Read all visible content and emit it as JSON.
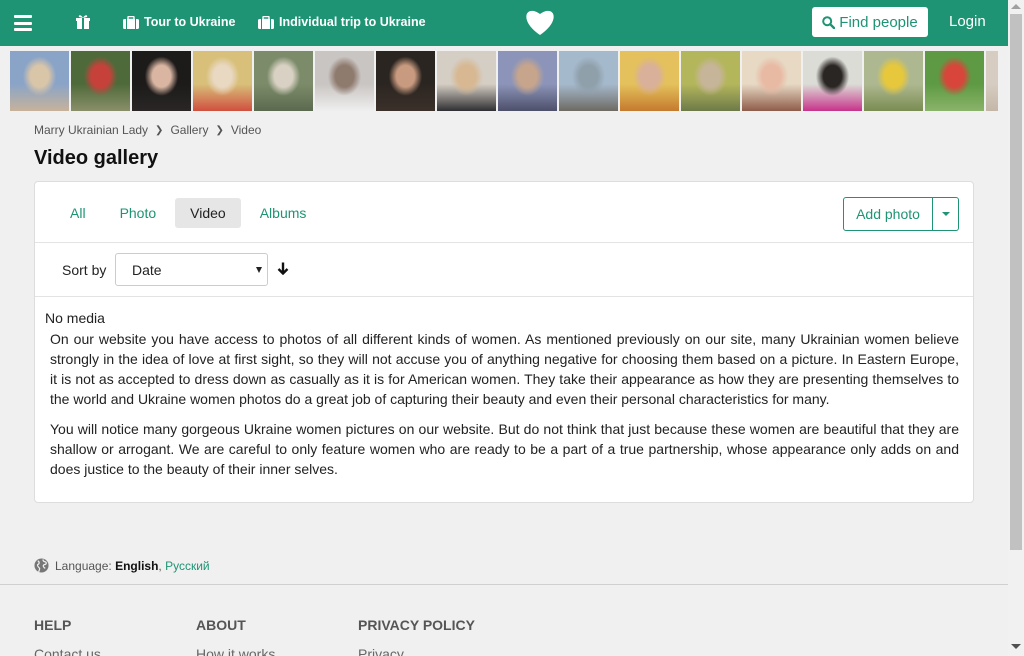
{
  "nav": {
    "tour_label": "Tour to Ukraine",
    "trip_label": "Individual trip to Ukraine",
    "find_label": "Find people",
    "login_label": "Login"
  },
  "strip": {
    "photos": [
      {
        "name": "profile-photo-1",
        "colors": [
          "#8aa4c8",
          "#d9c5a8",
          "#c7b29a"
        ]
      },
      {
        "name": "profile-photo-2",
        "colors": [
          "#4f6a3a",
          "#c7413b",
          "#8a8f6a"
        ]
      },
      {
        "name": "profile-photo-3",
        "colors": [
          "#1d1a1a",
          "#d9b5a2",
          "#2a2626"
        ]
      },
      {
        "name": "profile-photo-4",
        "colors": [
          "#d8c07a",
          "#e9d8c2",
          "#d04f3f"
        ]
      },
      {
        "name": "profile-photo-5",
        "colors": [
          "#7c8c6a",
          "#d9d2c4",
          "#5b6a4f"
        ]
      },
      {
        "name": "profile-photo-6",
        "colors": [
          "#c9c5c2",
          "#8f7a6e",
          "#efefef"
        ]
      },
      {
        "name": "profile-photo-7",
        "colors": [
          "#2b2521",
          "#c89a7f",
          "#3b302a"
        ]
      },
      {
        "name": "profile-photo-8",
        "colors": [
          "#d5cec4",
          "#d7b892",
          "#2f2f33"
        ]
      },
      {
        "name": "profile-photo-9",
        "colors": [
          "#8c95b9",
          "#c7a58c",
          "#4d4f6a"
        ]
      },
      {
        "name": "profile-photo-10",
        "colors": [
          "#a5b9cc",
          "#8fa0ab",
          "#6e6a63"
        ]
      },
      {
        "name": "profile-photo-11",
        "colors": [
          "#e4c15c",
          "#d9b09a",
          "#c57a2e"
        ]
      },
      {
        "name": "profile-photo-12",
        "colors": [
          "#b4b65c",
          "#c7b59a",
          "#6d7a48"
        ]
      },
      {
        "name": "profile-photo-13",
        "colors": [
          "#e7d9c4",
          "#e8b9a3",
          "#8e5c4a"
        ]
      },
      {
        "name": "profile-photo-14",
        "colors": [
          "#dcdcd6",
          "#2a2624",
          "#c7338a"
        ]
      },
      {
        "name": "profile-photo-15",
        "colors": [
          "#aeb890",
          "#e7c83c",
          "#7a8c52"
        ]
      },
      {
        "name": "profile-photo-16",
        "colors": [
          "#5e9a43",
          "#d8453a",
          "#8ab36a"
        ]
      },
      {
        "name": "profile-photo-17",
        "colors": [
          "#d7ccc1",
          "#5d7da8",
          "#c4b7a8"
        ]
      }
    ]
  },
  "breadcrumb": {
    "home": "Marry Ukrainian Lady",
    "gallery": "Gallery",
    "current": "Video"
  },
  "page": {
    "title": "Video gallery"
  },
  "tabs": {
    "all": "All",
    "photo": "Photo",
    "video": "Video",
    "albums": "Albums",
    "active": "video"
  },
  "actions": {
    "add_photo": "Add photo"
  },
  "sort": {
    "label": "Sort by",
    "selected": "Date",
    "direction": "descending"
  },
  "content": {
    "empty": "No media",
    "paragraph_1": "On our website you have access to photos of all different kinds of women. As mentioned previously on our site, many Ukrainian women believe strongly in the idea of love at first sight, so they will not accuse you of anything negative for choosing them based on a picture. In Eastern Europe, it is not as accepted to dress down as casually as it is for American women. They take their appearance as how they are presenting themselves to the world and Ukraine women photos do a great job of capturing their beauty and even their personal characteristics for many.",
    "paragraph_2": "You will notice many gorgeous Ukraine women pictures on our website. But do not think that just because these women are beautiful that they are shallow or arrogant. We are careful to only feature women who are ready to be a part of a true partnership, whose appearance only adds on and does justice to the beauty of their inner selves."
  },
  "footer": {
    "language_label": "Language:",
    "lang_en": "English",
    "lang_sep": ",",
    "lang_ru": "Русский",
    "help_heading": "HELP",
    "help_link": "Contact us",
    "about_heading": "ABOUT",
    "about_link": "How it works",
    "privacy_heading": "PRIVACY POLICY",
    "privacy_link": "Privacy"
  },
  "colors": {
    "brand": "#1e9474",
    "active_tab_bg": "#e6e6e6"
  }
}
